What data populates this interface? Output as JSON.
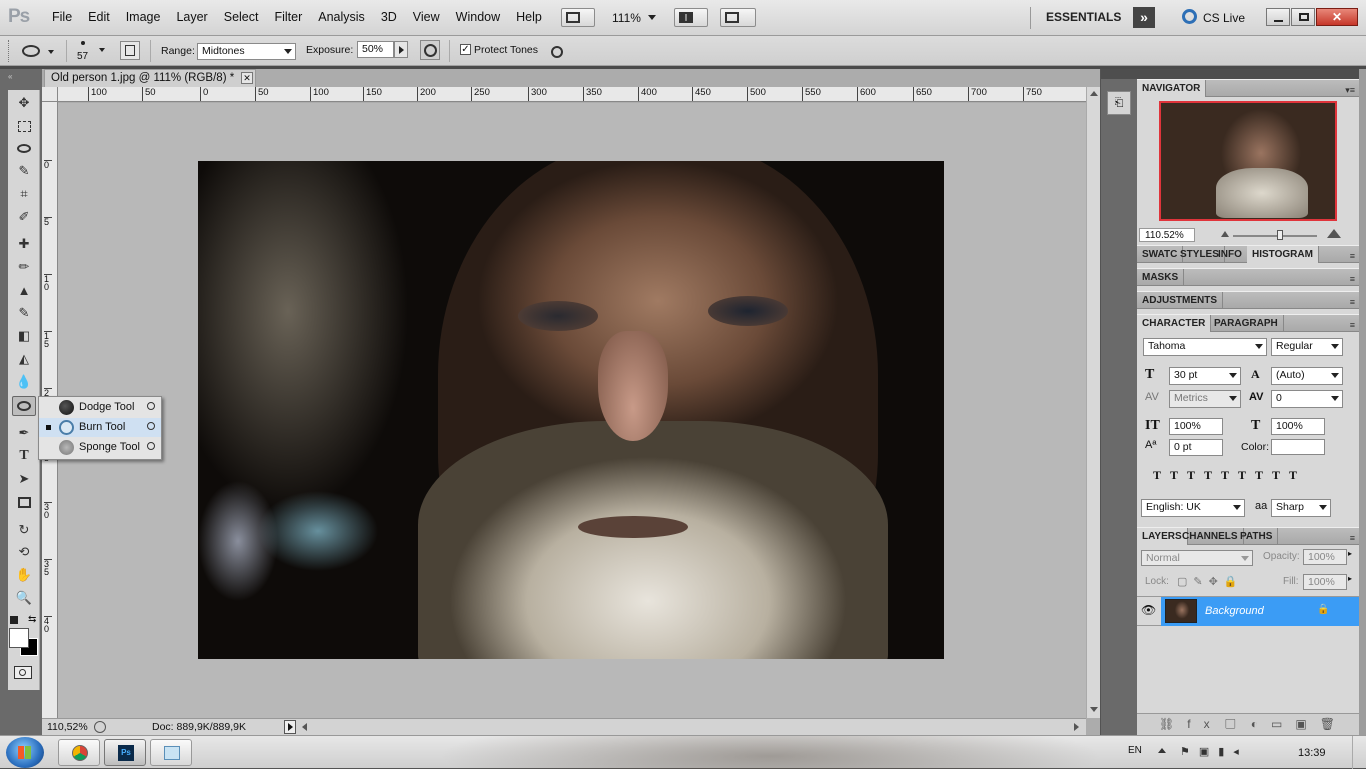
{
  "app": {
    "logo": "Ps",
    "menus": [
      "File",
      "Edit",
      "Image",
      "Layer",
      "Select",
      "Filter",
      "Analysis",
      "3D",
      "View",
      "Window",
      "Help"
    ],
    "zoom_dropdown": "111%",
    "workspace": "ESSENTIALS",
    "cs_live": "CS Live"
  },
  "options": {
    "brush_size": "57",
    "range_label": "Range:",
    "range_value": "Midtones",
    "exposure_label": "Exposure:",
    "exposure_value": "50%",
    "protect_tones": "Protect Tones",
    "protect_checked": true
  },
  "document": {
    "tab_title": "Old person 1.jpg @ 111% (RGB/8) *",
    "ruler_h": [
      "100",
      "50",
      "0",
      "50",
      "100",
      "150",
      "200",
      "250",
      "300",
      "350",
      "400",
      "450",
      "500",
      "550",
      "600",
      "650",
      "700",
      "750"
    ],
    "ruler_v": [
      "0",
      "5",
      "1 0",
      "1 5",
      "2 0",
      "2 5",
      "3 0",
      "3 5",
      "4 0"
    ],
    "status_zoom": "110,52%",
    "status_doc": "Doc: 889,9K/889,9K"
  },
  "flyout": {
    "items": [
      {
        "name": "Dodge Tool",
        "key": "O",
        "active": false
      },
      {
        "name": "Burn Tool",
        "key": "O",
        "active": true
      },
      {
        "name": "Sponge Tool",
        "key": "O",
        "active": false
      }
    ]
  },
  "panels": {
    "navigator_title": "NAVIGATOR",
    "navigator_zoom": "110.52%",
    "tabs_row1": [
      "SWATC",
      "STYLES",
      "INFO",
      "HISTOGRAM"
    ],
    "masks": "MASKS",
    "adjustments": "ADJUSTMENTS",
    "character_tabs": [
      "CHARACTER",
      "PARAGRAPH"
    ],
    "font_family": "Tahoma",
    "font_style": "Regular",
    "font_size": "30 pt",
    "leading": "(Auto)",
    "kerning": "Metrics",
    "tracking": "0",
    "vscale": "100%",
    "hscale": "100%",
    "baseline": "0 pt",
    "color_label": "Color:",
    "language": "English: UK",
    "aa_label": "a",
    "antialias": "Sharp",
    "layer_tabs": [
      "LAYERS",
      "CHANNELS",
      "PATHS"
    ],
    "blend_mode": "Normal",
    "opacity_label": "Opacity:",
    "opacity": "100%",
    "lock_label": "Lock:",
    "fill_label": "Fill:",
    "fill": "100%",
    "layer_name": "Background"
  },
  "taskbar": {
    "lang": "EN",
    "time": "13:39"
  },
  "colors": {
    "accent": "#3399ff",
    "layer_selected": "#3b9cf5",
    "nav_frame": "#e0343b"
  }
}
